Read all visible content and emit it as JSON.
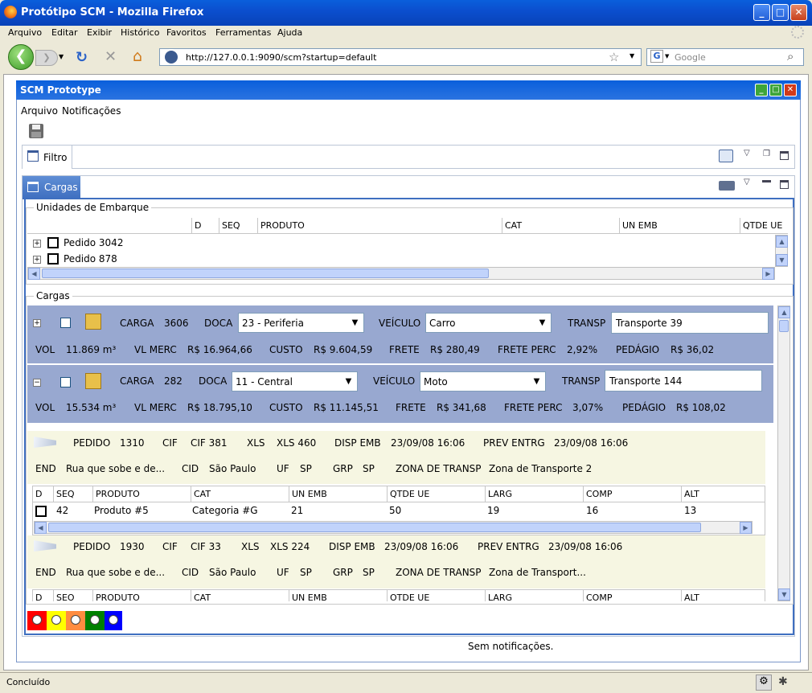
{
  "browser": {
    "title": "Protótipo SCM - Mozilla Firefox",
    "menu": [
      "Arquivo",
      "Editar",
      "Exibir",
      "Histórico",
      "Favoritos",
      "Ferramentas",
      "Ajuda"
    ],
    "url": "http://127.0.0.1:9090/scm?startup=default",
    "search_placeholder": "Google",
    "status": "Concluído"
  },
  "app": {
    "title": "SCM Prototype",
    "menu": [
      "Arquivo",
      "Notificações"
    ],
    "filter_tab": "Filtro",
    "cargas_tab": "Cargas",
    "notifications": "Sem notificações."
  },
  "unidades": {
    "legend": "Unidades de Embarque",
    "columns": [
      "D",
      "SEQ",
      "PRODUTO",
      "CAT",
      "UN EMB",
      "QTDE UE"
    ],
    "rows": [
      "Pedido 3042",
      "Pedido 878"
    ]
  },
  "cargas": {
    "legend": "Cargas",
    "labels": {
      "carga": "CARGA",
      "doca": "DOCA",
      "veiculo": "VEÍCULO",
      "transp": "TRANSP",
      "vol": "VOL",
      "vlmerc": "VL MERC",
      "custo": "CUSTO",
      "frete": "FRETE",
      "freteperc": "FRETE PERC",
      "pedagio": "PEDÁGIO"
    },
    "items": [
      {
        "expander": "+",
        "carga": "3606",
        "doca": "23 - Periferia",
        "veiculo": "Carro",
        "transp": "Transporte 39",
        "vol": "11.869 m³",
        "vlmerc": "R$ 16.964,66",
        "custo": "R$ 9.604,59",
        "frete": "R$ 280,49",
        "freteperc": "2,92%",
        "pedagio": "R$ 36,02"
      },
      {
        "expander": "−",
        "carga": "282",
        "doca": "11 - Central",
        "veiculo": "Moto",
        "transp": "Transporte 144",
        "vol": "15.534 m³",
        "vlmerc": "R$ 18.795,10",
        "custo": "R$ 11.145,51",
        "frete": "R$ 341,68",
        "freteperc": "3,07%",
        "pedagio": "R$ 108,02"
      }
    ]
  },
  "pedidos": {
    "labels": {
      "pedido": "PEDIDO",
      "cif": "CIF",
      "xls": "XLS",
      "dispemb": "DISP EMB",
      "preventrg": "PREV ENTRG",
      "end": "END",
      "cid": "CID",
      "uf": "UF",
      "grp": "GRP",
      "zona": "ZONA DE TRANSP"
    },
    "columns": [
      "D",
      "SEQ",
      "PRODUTO",
      "CAT",
      "UN EMB",
      "QTDE UE",
      "LARG",
      "COMP",
      "ALT"
    ],
    "columns_cut": [
      "D",
      "SEO",
      "PRODUTO",
      "CAT",
      "UN EMB",
      "OTDE UE",
      "LARG",
      "COMP",
      "ALT"
    ],
    "items": [
      {
        "pedido": "1310",
        "cif": "CIF 381",
        "xls": "XLS 460",
        "dispemb": "23/09/08 16:06",
        "preventrg": "23/09/08 16:06",
        "end": "Rua que sobe e de...",
        "cid": "São Paulo",
        "uf": "SP",
        "grp": "SP",
        "zona": "Zona de Transporte 2",
        "row": {
          "seq": "42",
          "produto": "Produto #5",
          "cat": "Categoria #G",
          "unemb": "21",
          "qtde": "50",
          "larg": "19",
          "comp": "16",
          "alt": "13"
        }
      },
      {
        "pedido": "1930",
        "cif": "CIF 33",
        "xls": "XLS 224",
        "dispemb": "23/09/08 16:06",
        "preventrg": "23/09/08 16:06",
        "end": "Rua que sobe e de...",
        "cid": "São Paulo",
        "uf": "SP",
        "grp": "SP",
        "zona": "Zona de Transport..."
      }
    ]
  },
  "colors": {
    "legend": [
      "#ff0000",
      "#ffff00",
      "#ff8c40",
      "#008000",
      "#0000ff"
    ]
  }
}
